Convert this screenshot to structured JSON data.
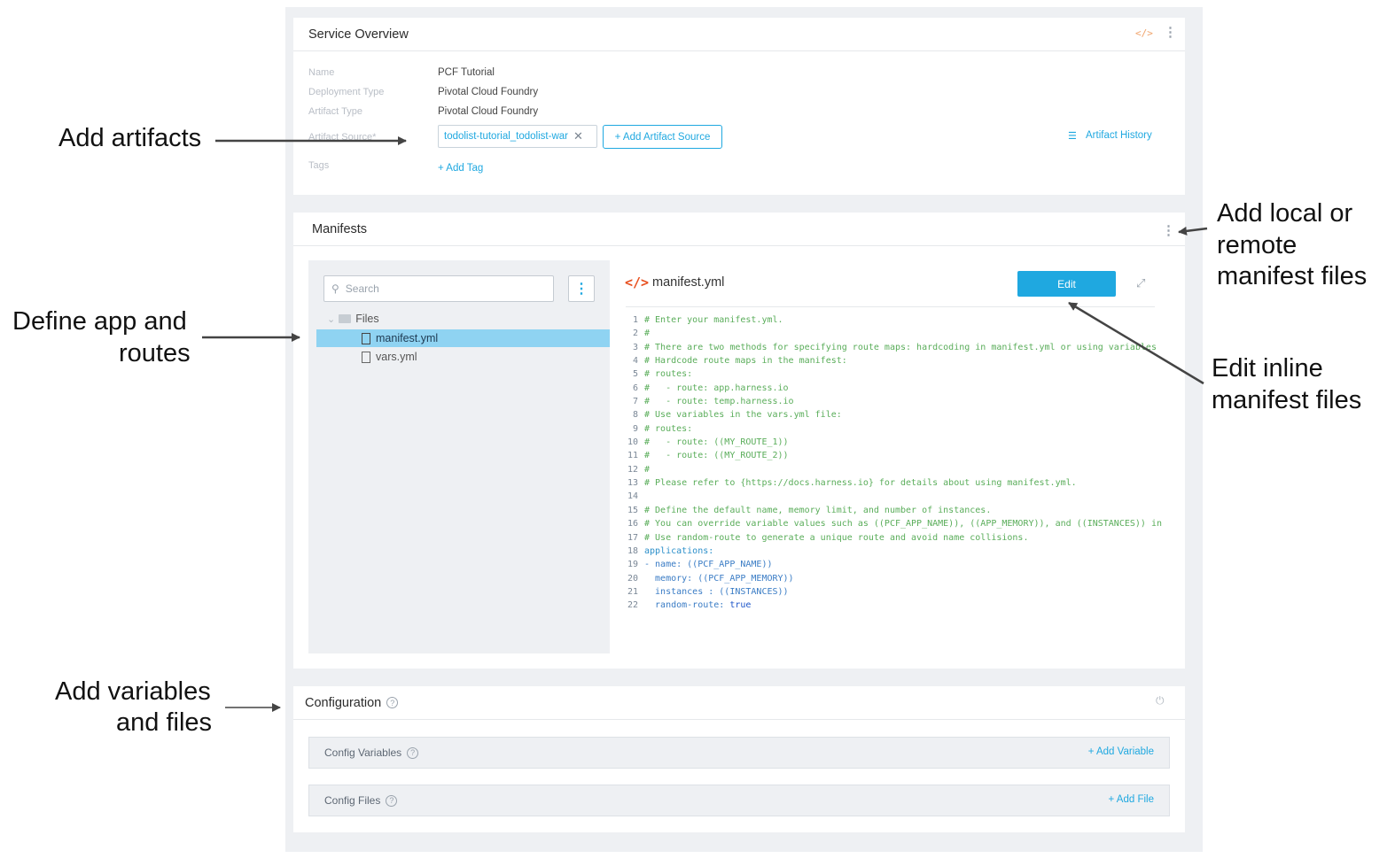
{
  "service_overview": {
    "title": "Service Overview",
    "code_icon": "</>",
    "fields": {
      "name_label": "Name",
      "name_value": "PCF Tutorial",
      "deployment_type_label": "Deployment Type",
      "deployment_type_value": "Pivotal Cloud Foundry",
      "artifact_type_label": "Artifact Type",
      "artifact_type_value": "Pivotal Cloud Foundry",
      "artifact_source_label": "Artifact Source*",
      "artifact_source_value": "todolist-tutorial_todolist-war",
      "add_artifact_source": "+ Add Artifact Source",
      "artifact_history": "Artifact History",
      "tags_label": "Tags",
      "add_tag": "+ Add Tag"
    }
  },
  "manifests": {
    "title": "Manifests",
    "search_placeholder": "Search",
    "tree": {
      "folder": "Files",
      "files": [
        "manifest.yml",
        "vars.yml"
      ],
      "selected": "manifest.yml"
    },
    "editor": {
      "file_icon": "</>",
      "file_name": "manifest.yml",
      "edit_button": "Edit",
      "lines": [
        {
          "n": "1",
          "parts": [
            {
              "t": "# Enter your manifest.yml.",
              "c": "c-com"
            }
          ]
        },
        {
          "n": "2",
          "parts": [
            {
              "t": "#",
              "c": "c-com"
            }
          ]
        },
        {
          "n": "3",
          "parts": [
            {
              "t": "# There are two methods for specifying route maps: hardcoding in manifest.yml or using variables",
              "c": "c-com"
            }
          ]
        },
        {
          "n": "4",
          "parts": [
            {
              "t": "# Hardcode route maps in the manifest:",
              "c": "c-com"
            }
          ]
        },
        {
          "n": "5",
          "parts": [
            {
              "t": "# routes:",
              "c": "c-com"
            }
          ]
        },
        {
          "n": "6",
          "parts": [
            {
              "t": "#   - route: app.harness.io",
              "c": "c-com"
            }
          ]
        },
        {
          "n": "7",
          "parts": [
            {
              "t": "#   - route: temp.harness.io",
              "c": "c-com"
            }
          ]
        },
        {
          "n": "8",
          "parts": [
            {
              "t": "# Use variables in the vars.yml file:",
              "c": "c-com"
            }
          ]
        },
        {
          "n": "9",
          "parts": [
            {
              "t": "# routes:",
              "c": "c-com"
            }
          ]
        },
        {
          "n": "10",
          "parts": [
            {
              "t": "#   - route: ((MY_ROUTE_1))",
              "c": "c-com"
            }
          ]
        },
        {
          "n": "11",
          "parts": [
            {
              "t": "#   - route: ((MY_ROUTE_2))",
              "c": "c-com"
            }
          ]
        },
        {
          "n": "12",
          "parts": [
            {
              "t": "#",
              "c": "c-com"
            }
          ]
        },
        {
          "n": "13",
          "parts": [
            {
              "t": "# Please refer to {https://docs.harness.io} for details about using manifest.yml.",
              "c": "c-com"
            }
          ]
        },
        {
          "n": "14",
          "parts": [
            {
              "t": "",
              "c": "c-com"
            }
          ]
        },
        {
          "n": "15",
          "parts": [
            {
              "t": "# Define the default name, memory limit, and number of instances.",
              "c": "c-com"
            }
          ]
        },
        {
          "n": "16",
          "parts": [
            {
              "t": "# You can override variable values such as ((PCF_APP_NAME)), ((APP_MEMORY)), and ((INSTANCES)) in",
              "c": "c-com"
            }
          ]
        },
        {
          "n": "17",
          "parts": [
            {
              "t": "# Use random-route to generate a unique route and avoid name collisions.",
              "c": "c-com"
            }
          ]
        },
        {
          "n": "18",
          "parts": [
            {
              "t": "applications:",
              "c": "c-key"
            }
          ]
        },
        {
          "n": "19",
          "parts": [
            {
              "t": "- name: ((PCF_APP_NAME))",
              "c": "c-plain"
            }
          ]
        },
        {
          "n": "20",
          "parts": [
            {
              "t": "  memory: ((PCF_APP_MEMORY))",
              "c": "c-plain"
            }
          ]
        },
        {
          "n": "21",
          "parts": [
            {
              "t": "  instances : ((INSTANCES))",
              "c": "c-plain"
            }
          ]
        },
        {
          "n": "22",
          "parts": [
            {
              "t": "  random-route: ",
              "c": "c-plain"
            },
            {
              "t": "true",
              "c": "c-true"
            }
          ]
        }
      ]
    }
  },
  "configuration": {
    "title": "Configuration",
    "config_variables": "Config Variables",
    "add_variable": "+ Add Variable",
    "config_files": "Config Files",
    "add_file": "+ Add File"
  },
  "annotations": {
    "add_artifacts": "Add artifacts",
    "define_app_line1": "Define app and",
    "define_app_line2": "routes",
    "add_variables_line1": "Add variables",
    "add_variables_line2": "and files",
    "add_local_line1": "Add local or",
    "add_local_line2": "remote",
    "add_local_line3": "manifest files",
    "edit_inline_line1": "Edit inline",
    "edit_inline_line2": "manifest files"
  },
  "colors": {
    "accent": "#1fa8e0",
    "selected_row": "#8fd3f2",
    "panel_bg": "#eef0f3",
    "code_icon": "#e8501f"
  }
}
